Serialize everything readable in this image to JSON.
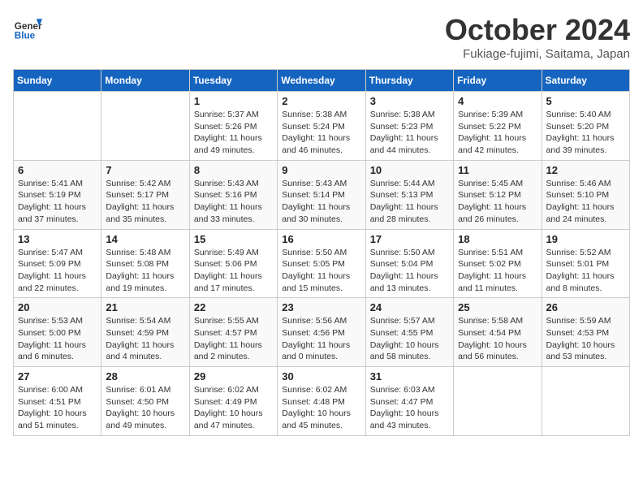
{
  "header": {
    "logo_general": "General",
    "logo_blue": "Blue",
    "month_title": "October 2024",
    "location": "Fukiage-fujimi, Saitama, Japan"
  },
  "columns": [
    "Sunday",
    "Monday",
    "Tuesday",
    "Wednesday",
    "Thursday",
    "Friday",
    "Saturday"
  ],
  "weeks": [
    [
      {
        "day": "",
        "sunrise": "",
        "sunset": "",
        "daylight": ""
      },
      {
        "day": "",
        "sunrise": "",
        "sunset": "",
        "daylight": ""
      },
      {
        "day": "1",
        "sunrise": "Sunrise: 5:37 AM",
        "sunset": "Sunset: 5:26 PM",
        "daylight": "Daylight: 11 hours and 49 minutes."
      },
      {
        "day": "2",
        "sunrise": "Sunrise: 5:38 AM",
        "sunset": "Sunset: 5:24 PM",
        "daylight": "Daylight: 11 hours and 46 minutes."
      },
      {
        "day": "3",
        "sunrise": "Sunrise: 5:38 AM",
        "sunset": "Sunset: 5:23 PM",
        "daylight": "Daylight: 11 hours and 44 minutes."
      },
      {
        "day": "4",
        "sunrise": "Sunrise: 5:39 AM",
        "sunset": "Sunset: 5:22 PM",
        "daylight": "Daylight: 11 hours and 42 minutes."
      },
      {
        "day": "5",
        "sunrise": "Sunrise: 5:40 AM",
        "sunset": "Sunset: 5:20 PM",
        "daylight": "Daylight: 11 hours and 39 minutes."
      }
    ],
    [
      {
        "day": "6",
        "sunrise": "Sunrise: 5:41 AM",
        "sunset": "Sunset: 5:19 PM",
        "daylight": "Daylight: 11 hours and 37 minutes."
      },
      {
        "day": "7",
        "sunrise": "Sunrise: 5:42 AM",
        "sunset": "Sunset: 5:17 PM",
        "daylight": "Daylight: 11 hours and 35 minutes."
      },
      {
        "day": "8",
        "sunrise": "Sunrise: 5:43 AM",
        "sunset": "Sunset: 5:16 PM",
        "daylight": "Daylight: 11 hours and 33 minutes."
      },
      {
        "day": "9",
        "sunrise": "Sunrise: 5:43 AM",
        "sunset": "Sunset: 5:14 PM",
        "daylight": "Daylight: 11 hours and 30 minutes."
      },
      {
        "day": "10",
        "sunrise": "Sunrise: 5:44 AM",
        "sunset": "Sunset: 5:13 PM",
        "daylight": "Daylight: 11 hours and 28 minutes."
      },
      {
        "day": "11",
        "sunrise": "Sunrise: 5:45 AM",
        "sunset": "Sunset: 5:12 PM",
        "daylight": "Daylight: 11 hours and 26 minutes."
      },
      {
        "day": "12",
        "sunrise": "Sunrise: 5:46 AM",
        "sunset": "Sunset: 5:10 PM",
        "daylight": "Daylight: 11 hours and 24 minutes."
      }
    ],
    [
      {
        "day": "13",
        "sunrise": "Sunrise: 5:47 AM",
        "sunset": "Sunset: 5:09 PM",
        "daylight": "Daylight: 11 hours and 22 minutes."
      },
      {
        "day": "14",
        "sunrise": "Sunrise: 5:48 AM",
        "sunset": "Sunset: 5:08 PM",
        "daylight": "Daylight: 11 hours and 19 minutes."
      },
      {
        "day": "15",
        "sunrise": "Sunrise: 5:49 AM",
        "sunset": "Sunset: 5:06 PM",
        "daylight": "Daylight: 11 hours and 17 minutes."
      },
      {
        "day": "16",
        "sunrise": "Sunrise: 5:50 AM",
        "sunset": "Sunset: 5:05 PM",
        "daylight": "Daylight: 11 hours and 15 minutes."
      },
      {
        "day": "17",
        "sunrise": "Sunrise: 5:50 AM",
        "sunset": "Sunset: 5:04 PM",
        "daylight": "Daylight: 11 hours and 13 minutes."
      },
      {
        "day": "18",
        "sunrise": "Sunrise: 5:51 AM",
        "sunset": "Sunset: 5:02 PM",
        "daylight": "Daylight: 11 hours and 11 minutes."
      },
      {
        "day": "19",
        "sunrise": "Sunrise: 5:52 AM",
        "sunset": "Sunset: 5:01 PM",
        "daylight": "Daylight: 11 hours and 8 minutes."
      }
    ],
    [
      {
        "day": "20",
        "sunrise": "Sunrise: 5:53 AM",
        "sunset": "Sunset: 5:00 PM",
        "daylight": "Daylight: 11 hours and 6 minutes."
      },
      {
        "day": "21",
        "sunrise": "Sunrise: 5:54 AM",
        "sunset": "Sunset: 4:59 PM",
        "daylight": "Daylight: 11 hours and 4 minutes."
      },
      {
        "day": "22",
        "sunrise": "Sunrise: 5:55 AM",
        "sunset": "Sunset: 4:57 PM",
        "daylight": "Daylight: 11 hours and 2 minutes."
      },
      {
        "day": "23",
        "sunrise": "Sunrise: 5:56 AM",
        "sunset": "Sunset: 4:56 PM",
        "daylight": "Daylight: 11 hours and 0 minutes."
      },
      {
        "day": "24",
        "sunrise": "Sunrise: 5:57 AM",
        "sunset": "Sunset: 4:55 PM",
        "daylight": "Daylight: 10 hours and 58 minutes."
      },
      {
        "day": "25",
        "sunrise": "Sunrise: 5:58 AM",
        "sunset": "Sunset: 4:54 PM",
        "daylight": "Daylight: 10 hours and 56 minutes."
      },
      {
        "day": "26",
        "sunrise": "Sunrise: 5:59 AM",
        "sunset": "Sunset: 4:53 PM",
        "daylight": "Daylight: 10 hours and 53 minutes."
      }
    ],
    [
      {
        "day": "27",
        "sunrise": "Sunrise: 6:00 AM",
        "sunset": "Sunset: 4:51 PM",
        "daylight": "Daylight: 10 hours and 51 minutes."
      },
      {
        "day": "28",
        "sunrise": "Sunrise: 6:01 AM",
        "sunset": "Sunset: 4:50 PM",
        "daylight": "Daylight: 10 hours and 49 minutes."
      },
      {
        "day": "29",
        "sunrise": "Sunrise: 6:02 AM",
        "sunset": "Sunset: 4:49 PM",
        "daylight": "Daylight: 10 hours and 47 minutes."
      },
      {
        "day": "30",
        "sunrise": "Sunrise: 6:02 AM",
        "sunset": "Sunset: 4:48 PM",
        "daylight": "Daylight: 10 hours and 45 minutes."
      },
      {
        "day": "31",
        "sunrise": "Sunrise: 6:03 AM",
        "sunset": "Sunset: 4:47 PM",
        "daylight": "Daylight: 10 hours and 43 minutes."
      },
      {
        "day": "",
        "sunrise": "",
        "sunset": "",
        "daylight": ""
      },
      {
        "day": "",
        "sunrise": "",
        "sunset": "",
        "daylight": ""
      }
    ]
  ]
}
